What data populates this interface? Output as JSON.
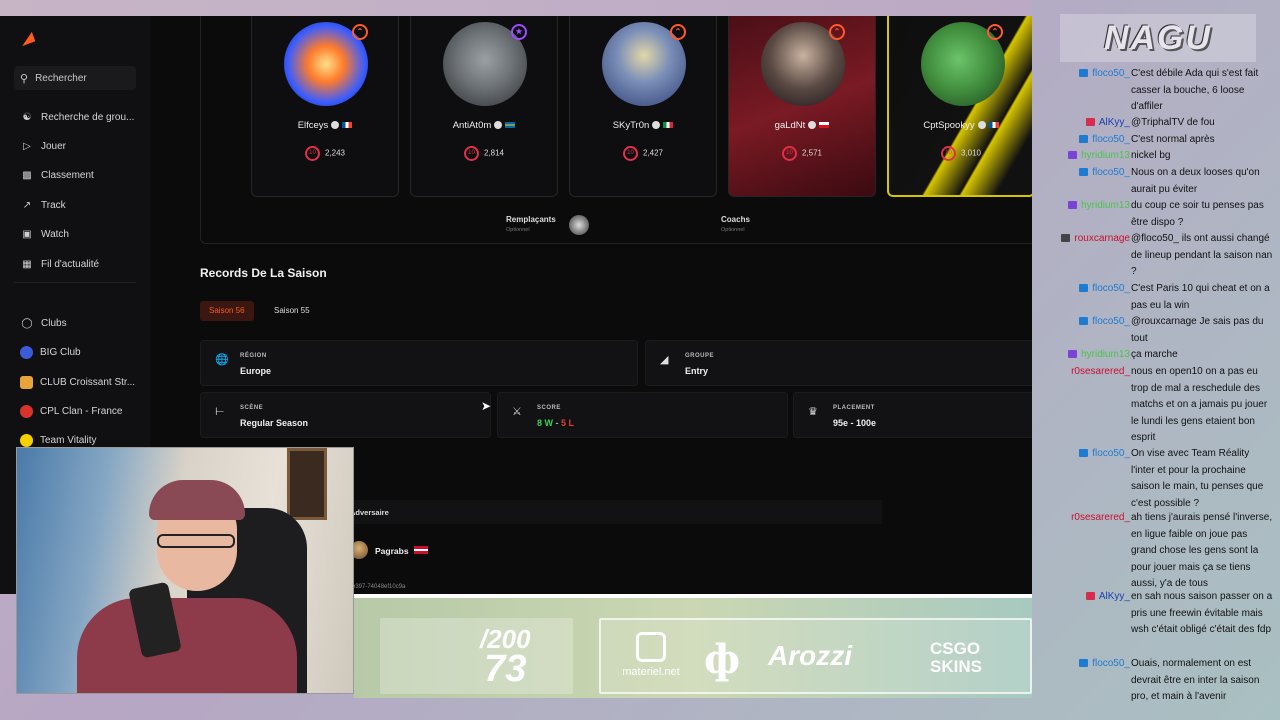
{
  "sidebar": {
    "search_label": "Rechercher",
    "items": [
      {
        "label": "Recherche de grou...",
        "icon": "people-search-icon"
      },
      {
        "label": "Jouer",
        "icon": "play-icon"
      },
      {
        "label": "Classement",
        "icon": "leaderboard-icon"
      },
      {
        "label": "Track",
        "icon": "track-icon"
      },
      {
        "label": "Watch",
        "icon": "watch-icon"
      },
      {
        "label": "Fil d'actualité",
        "icon": "feed-icon"
      }
    ],
    "clubs": [
      {
        "label": "Clubs",
        "color": "#cfcfcf"
      },
      {
        "label": "BIG Club",
        "color": "#3b5bdb"
      },
      {
        "label": "CLUB Croissant Str...",
        "color": "#e8a33a"
      },
      {
        "label": "CPL Clan - France",
        "color": "#d9342b"
      },
      {
        "label": "Team Vitality",
        "color": "#f5d100"
      }
    ]
  },
  "roster": {
    "players": [
      {
        "name": "Elfceys",
        "elo": "2,243",
        "level": "10"
      },
      {
        "name": "AntiAt0m",
        "elo": "2,814",
        "level": "10"
      },
      {
        "name": "SKyTr0n",
        "elo": "2,427",
        "level": "10"
      },
      {
        "name": "gaLdNt",
        "elo": "2,571",
        "level": "10"
      },
      {
        "name": "CptSpookyy",
        "elo": "3,010",
        "level": "10"
      }
    ],
    "subs_label": "Remplaçants",
    "subs_sub": "Optionnel",
    "coach_label": "Coachs",
    "coach_sub": "Optionnel"
  },
  "records": {
    "title": "Records De La Saison",
    "season_active": "Saison 56",
    "season_other": "Saison 55",
    "region_label": "RÉGION",
    "region_value": "Europe",
    "group_label": "GROUPE",
    "group_value": "Entry",
    "stage_label": "SCÈNE",
    "stage_value": "Regular Season",
    "score_label": "SCORE",
    "score_w": "8 W",
    "score_sep": " - ",
    "score_l": "5 L",
    "placement_label": "PLACEMENT",
    "placement_value": "95e - 100e"
  },
  "matches": {
    "col_opponent": "Adversaire",
    "opponent_name": "Pagrabs",
    "url_fragment": "e397-74048ef10c9a"
  },
  "overlay": {
    "sub_count_top": "/200",
    "sub_count_bottom": "73",
    "sponsors": [
      "materiel.net",
      "Arozzi",
      "CSGO SKINS"
    ]
  },
  "chat": {
    "channel_logo": "NAGU",
    "messages": [
      {
        "user": "floco50_",
        "color": "#1e7bd0",
        "icon": "#1e7bd0",
        "text": "C'est débile Ada qui s'est fait casser la bouche, 6 loose d'affiler"
      },
      {
        "user": "AlKyy_",
        "color": "#1b3fae",
        "icon": "#d62d4f",
        "text": "@TriphalTV de fou"
      },
      {
        "user": "floco50_",
        "color": "#1e7bd0",
        "icon": "#1e7bd0",
        "text": "C'est normal après"
      },
      {
        "user": "hyridium13",
        "color": "#4cc24c",
        "icon": "#7b42d6",
        "text": "nickel bg"
      },
      {
        "user": "floco50_",
        "color": "#1e7bd0",
        "icon": "#1e7bd0",
        "text": "Nous on a deux looses qu'on aurait pu éviter"
      },
      {
        "user": "hyridium13",
        "color": "#4cc24c",
        "icon": "#7b42d6",
        "text": "du coup ce soir tu penses pas être dispo ?"
      },
      {
        "user": "rouxcarnage",
        "color": "#c8102e",
        "icon": "#444444",
        "text": "@floco50_ ils ont aussi changé de lineup pendant la saison nan ?"
      },
      {
        "user": "floco50_",
        "color": "#1e7bd0",
        "icon": "#1e7bd0",
        "text": "C'est Paris 10 qui cheat et on a pas eu la win"
      },
      {
        "user": "floco50_",
        "color": "#1e7bd0",
        "icon": "#1e7bd0",
        "text": "@rouxcarnage Je sais pas du tout"
      },
      {
        "user": "hyridium13",
        "color": "#4cc24c",
        "icon": "#7b42d6",
        "text": "ça marche"
      },
      {
        "user": "r0sesarered_",
        "color": "#c8102e",
        "icon": "",
        "text": "nous en open10 on a pas eu trop de mal a reschedule des matchs et on a jamais pu jouer le lundi les gens etaient bon esprit"
      },
      {
        "user": "floco50_",
        "color": "#1e7bd0",
        "icon": "#1e7bd0",
        "text": "On vise avec Team Réality l'inter et pour la prochaine saison le main, tu penses que c'est possible ?"
      },
      {
        "user": "r0sesarered_",
        "color": "#c8102e",
        "icon": "",
        "text": "ah tiens j'aurais pensé l'inverse, en ligue faible on joue pas grand chose les gens sont la pour jouer mais ça se tiens aussi, y'a de tous"
      },
      {
        "user": "AlKyy_",
        "color": "#1b3fae",
        "icon": "#d62d4f",
        "text": "en sah nous saison passer on a pris une freewin évitable mais wsh c'était obligé c'était des fdp"
      },
      {
        "user": "floco50_",
        "color": "#1e7bd0",
        "icon": "#1e7bd0",
        "text": "Ouais, normalement on est devrait être en inter la saison pro, et main à l'avenir"
      }
    ]
  }
}
